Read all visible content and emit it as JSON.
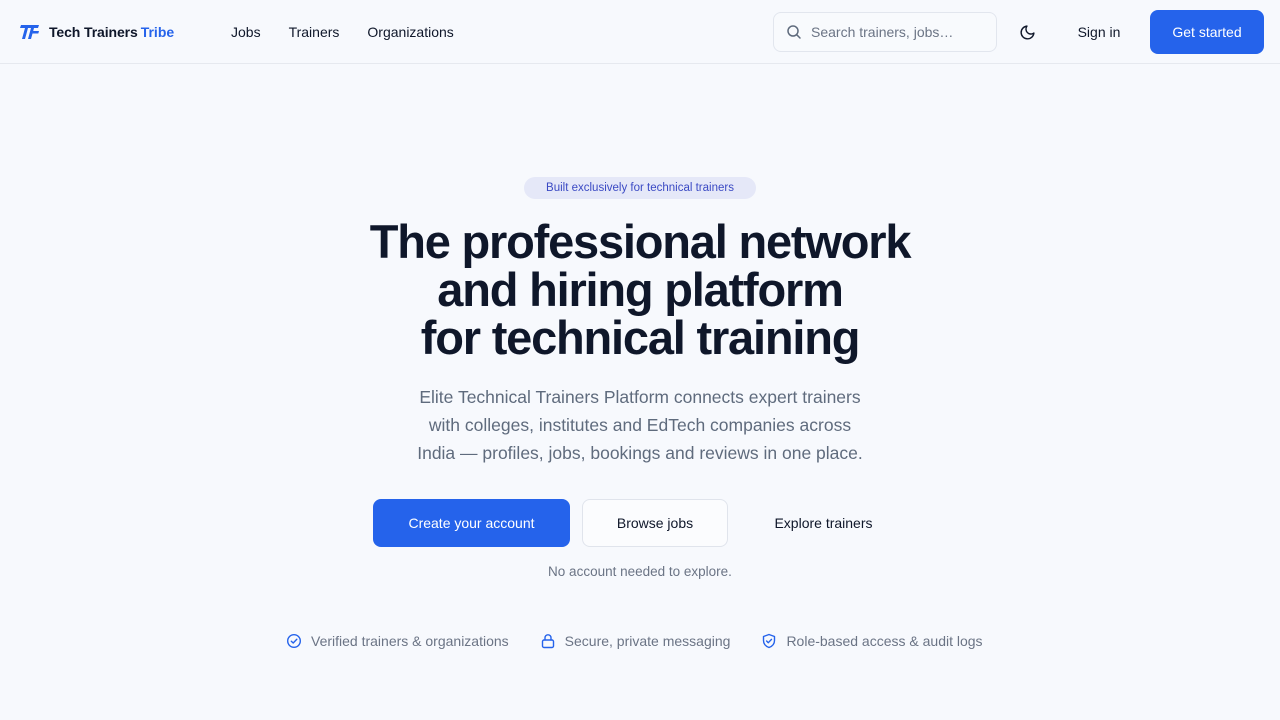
{
  "header": {
    "brand": {
      "name": "Tech Trainers",
      "accent": "Tribe",
      "logo_icon": "tt-logo-icon"
    },
    "nav": [
      {
        "label": "Jobs"
      },
      {
        "label": "Trainers"
      },
      {
        "label": "Organizations"
      }
    ],
    "search": {
      "placeholder": "Search trainers, jobs…",
      "value": "",
      "icon": "search-icon"
    },
    "theme_toggle_icon": "moon-icon",
    "sign_in": "Sign in",
    "get_started": "Get started"
  },
  "hero": {
    "badge": "Built exclusively for technical trainers",
    "title_lines": [
      "The professional network",
      "and hiring platform",
      "for technical training"
    ],
    "subtitle_lines": [
      "Elite Technical Trainers Platform connects expert trainers",
      "with colleges, institutes and EdTech companies across",
      "India — profiles, jobs, bookings and reviews in one place."
    ],
    "cta": {
      "primary": "Create your account",
      "secondary": "Browse jobs",
      "tertiary": "Explore trainers"
    },
    "note": "No account needed to explore.",
    "features": [
      {
        "icon": "check-circle-icon",
        "label": "Verified trainers & organizations"
      },
      {
        "icon": "lock-icon",
        "label": "Secure, private messaging"
      },
      {
        "icon": "shield-check-icon",
        "label": "Role-based access & audit logs"
      }
    ]
  },
  "colors": {
    "accent": "#2563eb",
    "background": "#f7f9fd",
    "text": "#0f172a",
    "muted": "#6b7485",
    "badge_bg": "#e5e8f8",
    "badge_text": "#3b4ac4"
  }
}
